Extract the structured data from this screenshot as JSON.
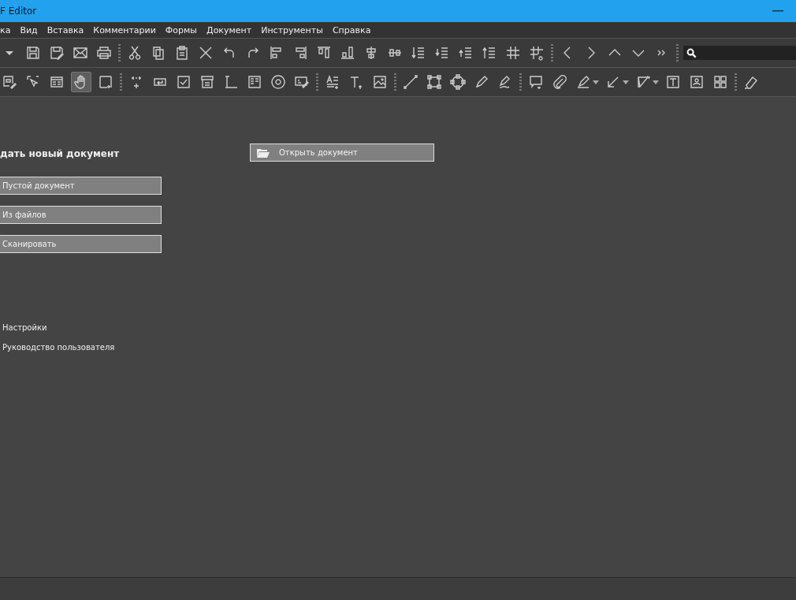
{
  "window": {
    "title": "F Editor"
  },
  "menu": [
    "ка",
    "Вид",
    "Вставка",
    "Комментарии",
    "Формы",
    "Документ",
    "Инструменты",
    "Справка"
  ],
  "toolbar_2": {
    "tools": [
      {
        "selected": false
      },
      {
        "selected": false
      },
      {
        "selected": false
      },
      {
        "selected": true
      },
      {
        "selected": false
      },
      {
        "selected": false
      },
      {
        "selected": false
      },
      {
        "selected": false
      },
      {
        "selected": false
      },
      {
        "selected": false
      },
      {
        "selected": false
      },
      {
        "selected": false
      },
      {
        "selected": false
      },
      {
        "selected": false
      },
      {
        "selected": false
      },
      {
        "selected": false
      },
      {
        "selected": false
      },
      {
        "selected": false
      },
      {
        "selected": false
      },
      {
        "selected": false
      },
      {
        "selected": false
      },
      {
        "selected": false
      },
      {
        "selected": false
      },
      {
        "selected": false
      },
      {
        "selected": false
      },
      {
        "selected": false
      },
      {
        "selected": false
      },
      {
        "selected": false
      },
      {
        "selected": false
      },
      {
        "selected": false
      }
    ]
  },
  "create": {
    "heading": "дать новый документ",
    "buttons": [
      "Пустой документ",
      "Из файлов",
      "Сканировать"
    ]
  },
  "open_button": "Открыть документ",
  "links": [
    "Настройки",
    "Руководство пользователя"
  ]
}
